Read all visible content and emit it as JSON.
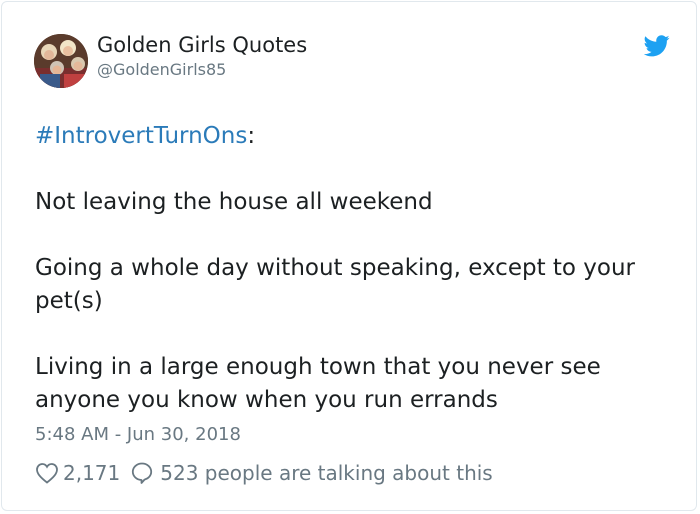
{
  "author": {
    "display_name": "Golden Girls Quotes",
    "handle": "@GoldenGirls85",
    "avatar_icon": "group-photo-avatar"
  },
  "brand": {
    "icon": "twitter-bird-icon",
    "color": "#1da1f2"
  },
  "tweet": {
    "hashtag": "#IntrovertTurnOns",
    "hashtag_suffix": ":",
    "lines": {
      "l1": "Not leaving the house all weekend",
      "l2": "Going a whole day without speaking, except to your pet(s)",
      "l3": "Living in a large enough town that you never see anyone you know when you run errands"
    },
    "timestamp": "5:48 AM - Jun 30, 2018"
  },
  "actions": {
    "likes": "2,171",
    "replies_text": "523 people are talking about this",
    "like_icon": "heart-icon",
    "reply_icon": "speech-bubble-icon"
  },
  "colors": {
    "hashtag": "#2b7bb9",
    "muted": "#697882",
    "text": "#1c2022"
  }
}
